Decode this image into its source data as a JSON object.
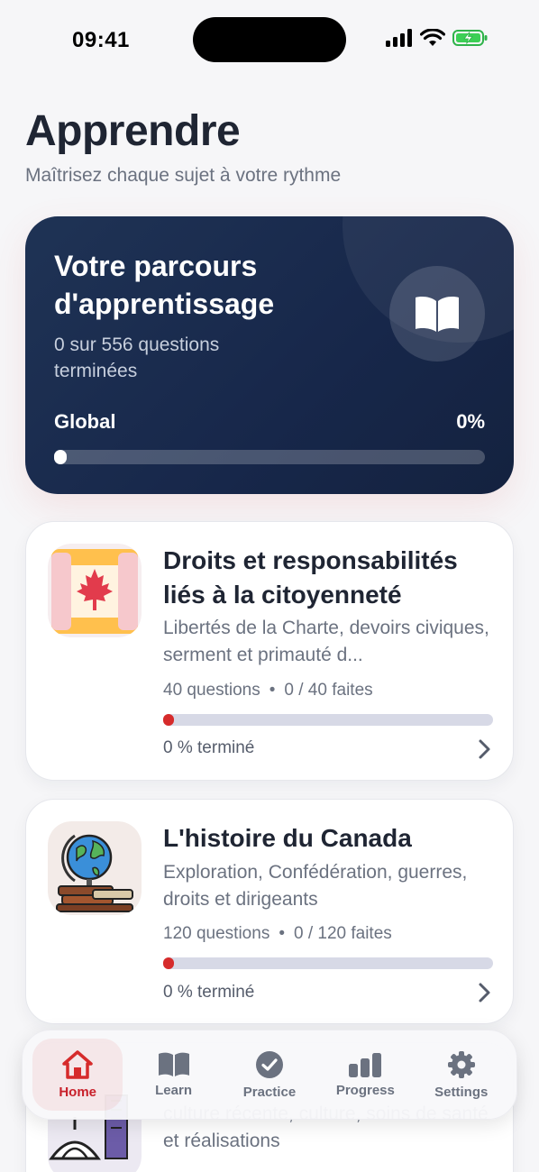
{
  "status_bar": {
    "time": "09:41"
  },
  "header": {
    "title": "Apprendre",
    "subtitle": "Maîtrisez chaque sujet à votre rythme"
  },
  "hero": {
    "title": "Votre parcours d'apprentissage",
    "subtitle": "0 sur 556 questions terminées",
    "progress_label": "Global",
    "progress_text": "0%",
    "progress_value": 0,
    "icon": "open-book-icon"
  },
  "topics": [
    {
      "title": "Droits et responsabilités liés à la citoyenneté",
      "description": "Libertés de la Charte, devoirs civiques, serment et primauté d...",
      "questions": "40 questions",
      "done": "0 / 40 faites",
      "progress_value": 0,
      "completed": "0 % terminé",
      "icon": "maple-leaf-scroll-icon"
    },
    {
      "title": "L'histoire du Canada",
      "description": "Exploration, Confédération, guerres, droits et dirigeants",
      "questions": "120 questions",
      "done": "0 / 120 faites",
      "progress_value": 0,
      "completed": "0 % terminé",
      "icon": "globe-books-icon"
    },
    {
      "description": "culture récente, culture, soins de santé et réalisations",
      "icon": "city-skyline-icon"
    }
  ],
  "tabbar": {
    "items": [
      {
        "label": "Home",
        "icon": "home-icon",
        "active": true
      },
      {
        "label": "Learn",
        "icon": "book-icon",
        "active": false
      },
      {
        "label": "Practice",
        "icon": "check-circle-icon",
        "active": false
      },
      {
        "label": "Progress",
        "icon": "bar-chart-icon",
        "active": false
      },
      {
        "label": "Settings",
        "icon": "gear-icon",
        "active": false
      }
    ]
  },
  "colors": {
    "accent": "#d62b2b",
    "hero_bg": "#1b2d4f",
    "track": "#d7d9e6"
  }
}
